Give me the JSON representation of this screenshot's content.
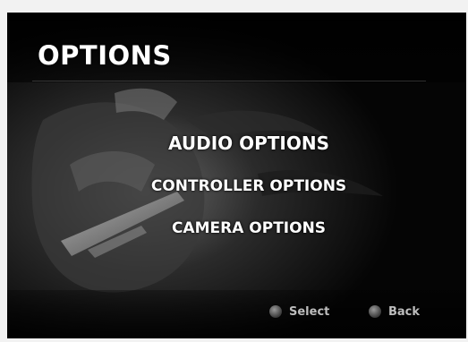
{
  "header": {
    "title": "OPTIONS"
  },
  "menu": {
    "items": [
      {
        "label": "AUDIO OPTIONS"
      },
      {
        "label": "CONTROLLER OPTIONS"
      },
      {
        "label": "CAMERA OPTIONS"
      }
    ]
  },
  "footer": {
    "select_label": "Select",
    "back_label": "Back",
    "select_icon": "circle-button-icon",
    "back_icon": "circle-button-icon"
  },
  "colors": {
    "background": "#050505",
    "text": "#ffffff",
    "footer_text": "#bdbdbd"
  }
}
